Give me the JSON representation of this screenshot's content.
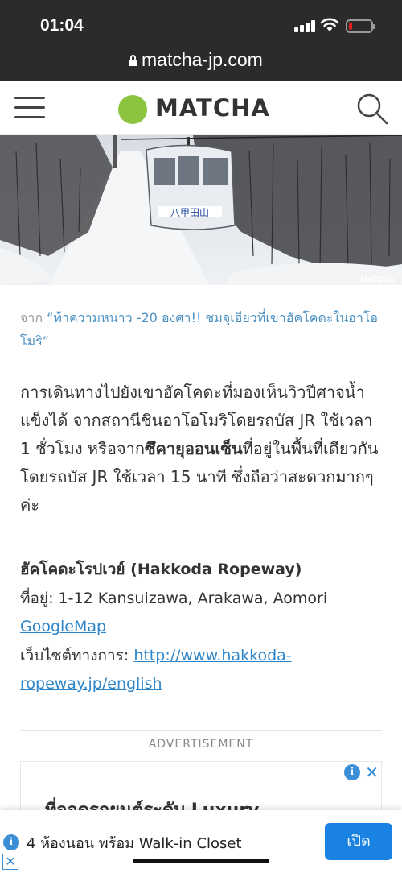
{
  "status": {
    "time": "01:04"
  },
  "browser": {
    "url": "matcha-jp.com"
  },
  "header": {
    "logo": "MATCHA"
  },
  "hero": {
    "watermark": "MATCHA",
    "gondola_sign": "八甲田山"
  },
  "article": {
    "source_prefix": "จาก",
    "source_link": "“ท้าความหนาว -20 องศา!! ชมจุเฮียวที่เขาฮัคโคดะในอาโอโมริ”",
    "paragraph_1": "การเดินทางไปยังเขาฮัคโคดะที่มองเห็นวิวปีศาจน้ำแข็งได้ จากสถานีชินอาโอโมริโดยรถบัส JR ใช้เวลา 1 ชั่วโมง หรือจาก",
    "paragraph_bold": "ซึคายุออนเซ็น",
    "paragraph_2": "ที่อยู่ในพื้นที่เดียวกันโดยรถบัส JR ใช้เวลา 15 นาที ซึ่งถือว่าสะดวกมากๆ ค่ะ",
    "place_title": "ฮัคโคดะโรปเวย์ (Hakkoda Ropeway)",
    "address_label": "ที่อยู่:",
    "address_value": "1-12 Kansuizawa, Arakawa, Aomori",
    "map_link": "GoogleMap",
    "website_label": "เว็บไซต์ทางการ:",
    "website_link": "http://www.hakkoda-ropeway.jp/english"
  },
  "ad": {
    "label": "ADVERTISEMENT",
    "partial_text": "ที่จอดรถยนต์ระดับ Luxury",
    "info_icon": "i",
    "close_icon": "✕"
  },
  "banner": {
    "info_icon": "i",
    "close_icon": "✕",
    "text": "4 ห้องนอน พร้อม Walk-in Closet",
    "button": "เปิด"
  }
}
